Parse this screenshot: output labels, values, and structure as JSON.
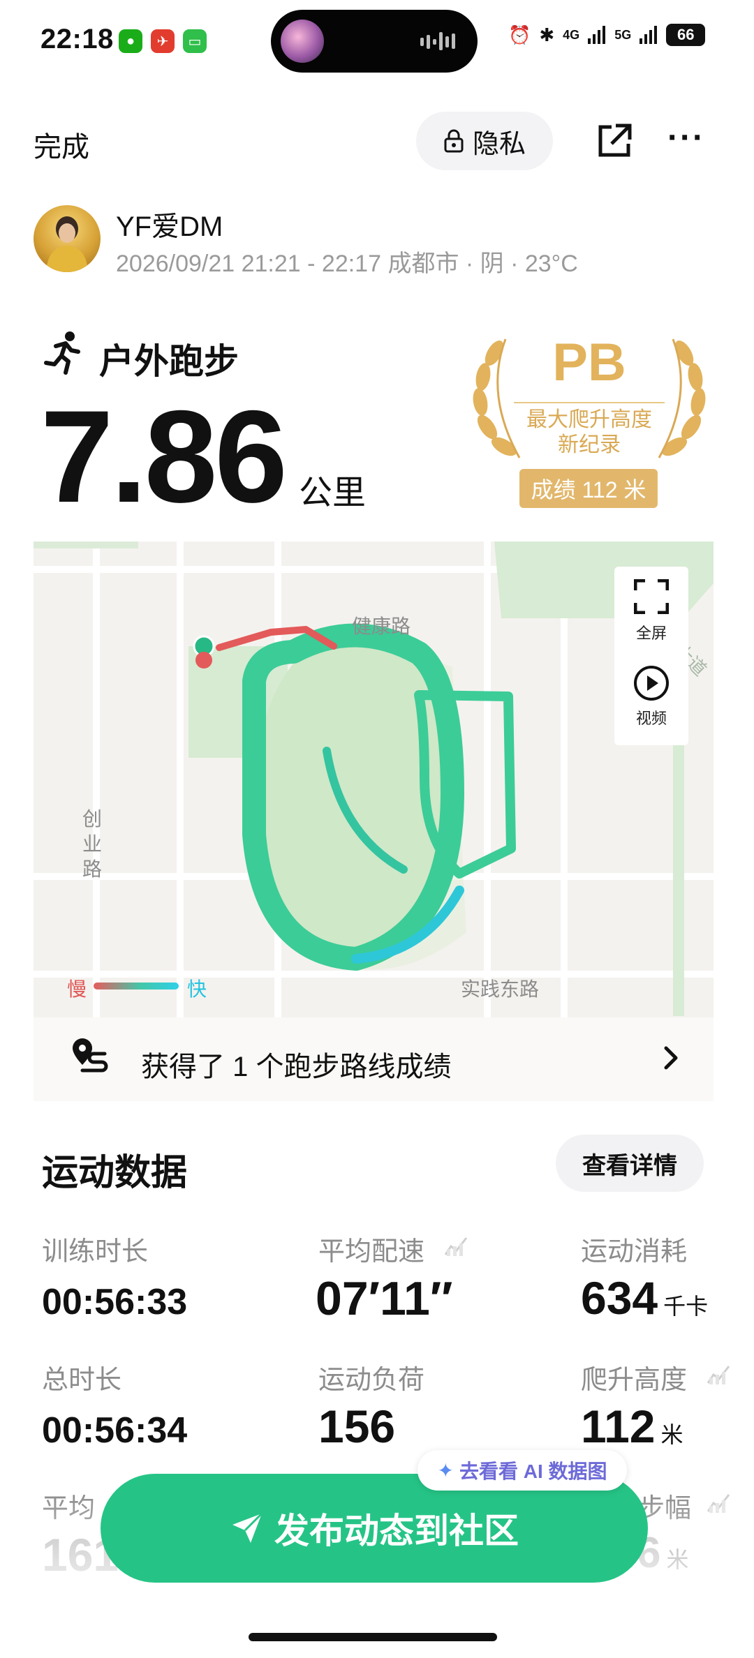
{
  "status_bar": {
    "time": "22:18",
    "signal_1": "4G",
    "signal_2": "5G",
    "battery": "66"
  },
  "top_bar": {
    "done_label": "完成",
    "privacy_label": "隐私"
  },
  "user": {
    "name": "YF爱DM",
    "meta": "2026/09/21 21:21 - 22:17 成都市 · 阴 · 23°C"
  },
  "activity": {
    "type": "户外跑步",
    "distance": "7.86",
    "distance_unit": "公里"
  },
  "pb_badge": {
    "title": "PB",
    "line1": "最大爬升高度",
    "line2": "新纪录",
    "score": "成绩 112 米"
  },
  "map": {
    "road_labels": {
      "north": "健康路",
      "west": "创业路",
      "south": "实践东路",
      "east": "大道"
    },
    "fullscreen_label": "全屏",
    "video_label": "视频",
    "legend": {
      "slow": "慢",
      "fast": "快"
    }
  },
  "route_achievement": {
    "text": "获得了 1 个跑步路线成绩"
  },
  "section": {
    "title": "运动数据",
    "details_label": "查看详情"
  },
  "stats": [
    {
      "label": "训练时长",
      "value": "00:56:33",
      "unit": ""
    },
    {
      "label": "平均配速",
      "value": "07′11″",
      "unit": ""
    },
    {
      "label": "运动消耗",
      "value": "634",
      "unit": "千卡"
    },
    {
      "label": "总时长",
      "value": "00:56:34",
      "unit": ""
    },
    {
      "label": "运动负荷",
      "value": "156",
      "unit": ""
    },
    {
      "label": "爬升高度",
      "value": "112",
      "unit": "米"
    },
    {
      "label": "平均",
      "value": "161",
      "unit": ""
    },
    {
      "label": "步幅",
      "value": "6",
      "unit": "米"
    }
  ],
  "ai_pill": {
    "label": "去看看 AI 数据图"
  },
  "publish": {
    "label": "发布动态到社区"
  },
  "colors": {
    "accent_green": "#25c486",
    "pb_gold": "#e2b35c",
    "track_green": "#3ccc98",
    "slow_red": "#e05555",
    "fast_cyan": "#25c3e0"
  }
}
